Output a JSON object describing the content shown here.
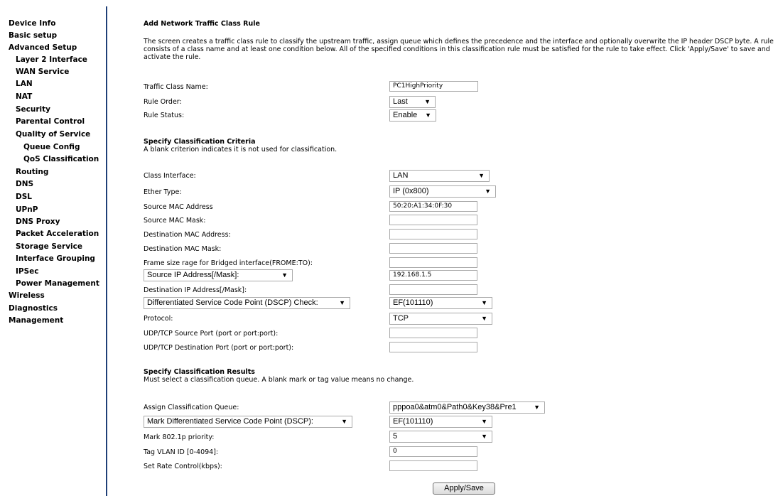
{
  "sidebar": {
    "items": [
      {
        "label": "Device Info"
      },
      {
        "label": "Basic setup"
      },
      {
        "label": "Advanced Setup"
      },
      {
        "label": "Layer 2 Interface"
      },
      {
        "label": "WAN Service"
      },
      {
        "label": "LAN"
      },
      {
        "label": "NAT"
      },
      {
        "label": "Security"
      },
      {
        "label": "Parental Control"
      },
      {
        "label": "Quality of Service"
      },
      {
        "label": "Queue Config"
      },
      {
        "label": "QoS Classification"
      },
      {
        "label": "Routing"
      },
      {
        "label": "DNS"
      },
      {
        "label": "DSL"
      },
      {
        "label": "UPnP"
      },
      {
        "label": "DNS Proxy"
      },
      {
        "label": "Packet Acceleration"
      },
      {
        "label": "Storage Service"
      },
      {
        "label": "Interface Grouping"
      },
      {
        "label": "IPSec"
      },
      {
        "label": "Power Management"
      },
      {
        "label": "Wireless"
      },
      {
        "label": "Diagnostics"
      },
      {
        "label": "Management"
      }
    ]
  },
  "page": {
    "title": "Add Network Traffic Class Rule",
    "description": "The screen creates a traffic class rule to classify the upstream traffic, assign queue which defines the precedence and the interface and optionally overwrite the IP header DSCP byte. A rule consists of a class name and at least one condition below. All of the specified conditions in this classification rule must be satisfied for the rule to take effect. Click 'Apply/Save' to save and activate the rule."
  },
  "rule": {
    "name_label": "Traffic Class Name:",
    "name_value": "PC1HighPriority",
    "order_label": "Rule Order:",
    "order_value": "Last",
    "status_label": "Rule Status:",
    "status_value": "Enable"
  },
  "criteria": {
    "heading": "Specify Classification Criteria",
    "note": "A blank criterion indicates it is not used for classification.",
    "class_interface_label": "Class Interface:",
    "class_interface_value": "LAN",
    "ether_type_label": "Ether Type:",
    "ether_type_value": "IP (0x800)",
    "src_mac_label": "Source MAC Address",
    "src_mac_value": "50:20:A1:34:0F:30",
    "src_mac_mask_label": "Source MAC Mask:",
    "src_mac_mask_value": "",
    "dst_mac_label": "Destination MAC Address:",
    "dst_mac_value": "",
    "dst_mac_mask_label": "Destination MAC Mask:",
    "dst_mac_mask_value": "",
    "frame_size_label": "Frame size rage for Bridged interface(FROME:TO):",
    "frame_size_value": "",
    "src_ip_select": "Source IP Address[/Mask]:",
    "src_ip_value": "192.168.1.5",
    "dst_ip_label": "Destination IP Address[/Mask]:",
    "dst_ip_value": "",
    "dscp_check_select": "Differentiated Service Code Point (DSCP) Check:",
    "dscp_check_value": "EF(101110)",
    "protocol_label": "Protocol:",
    "protocol_value": "TCP",
    "src_port_label": "UDP/TCP Source Port (port or port:port):",
    "src_port_value": "",
    "dst_port_label": "UDP/TCP Destination Port (port or port:port):",
    "dst_port_value": ""
  },
  "results": {
    "heading": "Specify Classification Results",
    "note": "Must select a classification queue. A blank mark or tag value means no change.",
    "queue_label": "Assign Classification Queue:",
    "queue_value": "pppoa0&atm0&Path0&Key38&Pre1",
    "dscp_mark_select": "Mark Differentiated Service Code Point (DSCP):",
    "dscp_mark_value": "EF(101110)",
    "p8021_label": "Mark 802.1p priority:",
    "p8021_value": "5",
    "vlan_label": "Tag VLAN ID [0-4094]:",
    "vlan_value": "0",
    "rate_label": "Set Rate Control(kbps):",
    "rate_value": ""
  },
  "actions": {
    "apply_label": "Apply/Save"
  },
  "icons": {
    "dropdown": "chevron-down-icon"
  }
}
